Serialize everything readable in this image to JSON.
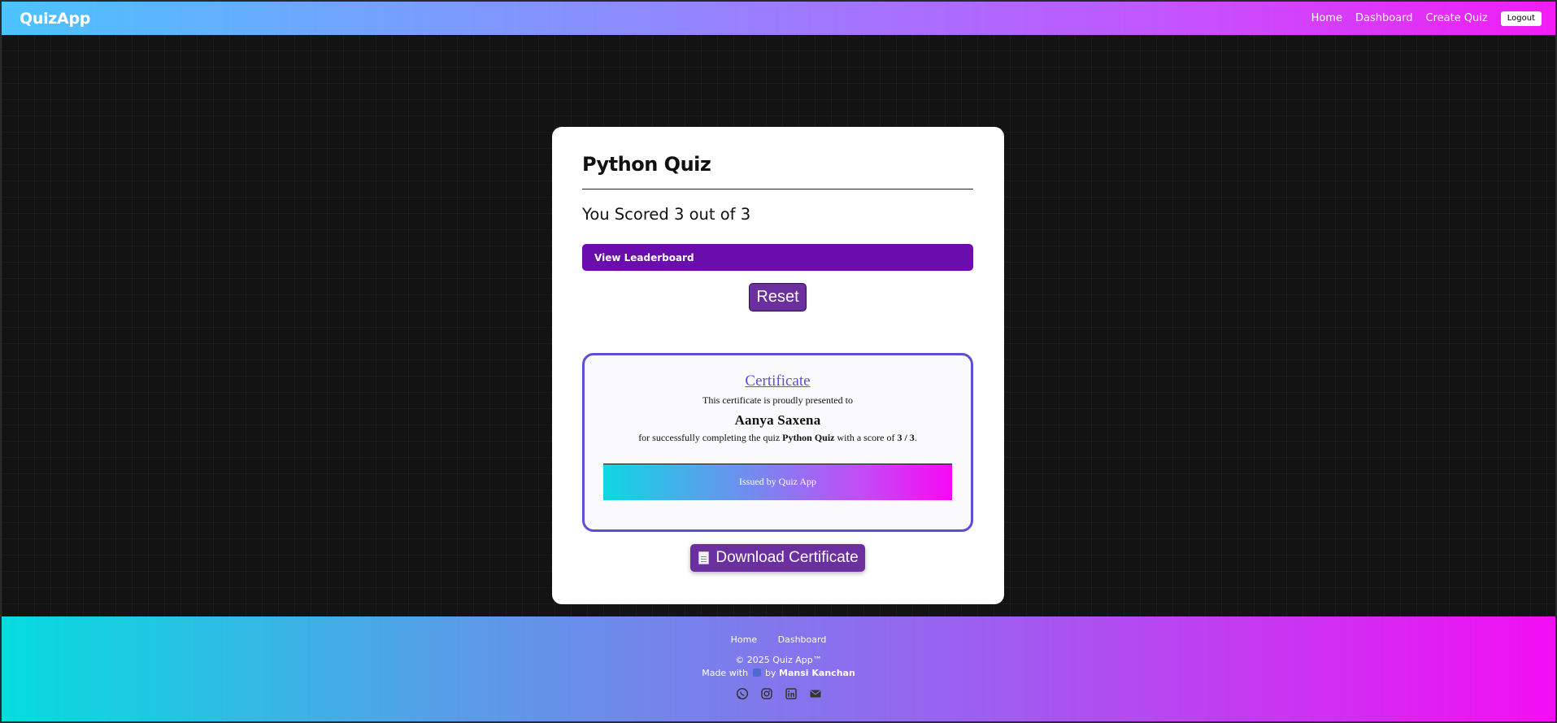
{
  "navbar": {
    "brand": "QuizApp",
    "links": [
      "Home",
      "Dashboard",
      "Create Quiz"
    ],
    "logout_label": "Logout"
  },
  "result": {
    "quiz_title": "Python Quiz",
    "score_text": "You Scored 3 out of 3",
    "leaderboard_label": "View Leaderboard",
    "reset_label": "Reset"
  },
  "certificate": {
    "title": "Certificate",
    "presented_text": "This certificate is proudly presented to",
    "recipient": "Aanya Saxena",
    "desc_prefix": "for successfully completing the quiz",
    "quiz_name": "Python Quiz",
    "desc_middle": "with a score of",
    "score": "3 / 3",
    "desc_suffix": ".",
    "issued_by": "Issued by Quiz App"
  },
  "download": {
    "icon": "document-icon",
    "label": "Download Certificate"
  },
  "footer": {
    "links": [
      "Home",
      "Dashboard"
    ],
    "copyright": "© 2025 Quiz App™",
    "made_with_prefix": "Made with",
    "made_with_by": "by",
    "author": "Mansi Kanchan",
    "socials": [
      "whatsapp-icon",
      "instagram-icon",
      "linkedin-icon",
      "email-icon"
    ]
  },
  "colors": {
    "primary_purple": "#6a0dad",
    "button_purple": "#6b2fa0",
    "cert_border": "#5b4fd6"
  }
}
